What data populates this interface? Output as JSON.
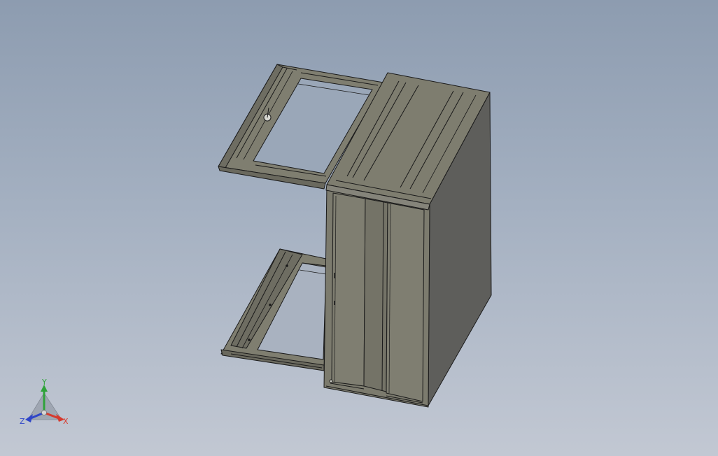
{
  "viewport": {
    "background_top": "#8d9cb0",
    "background_bottom": "#c2c8d3"
  },
  "model": {
    "part_fill": "#7e7d6f",
    "part_fill_dark": "#6f6e62",
    "side_fill": "#5e5e5b",
    "edge_color": "#1a1a1a"
  },
  "triad": {
    "x_label": "X",
    "y_label": "Y",
    "z_label": "Z",
    "x_color": "#d63a2e",
    "y_color": "#2fa33a",
    "z_color": "#2f46c8"
  }
}
